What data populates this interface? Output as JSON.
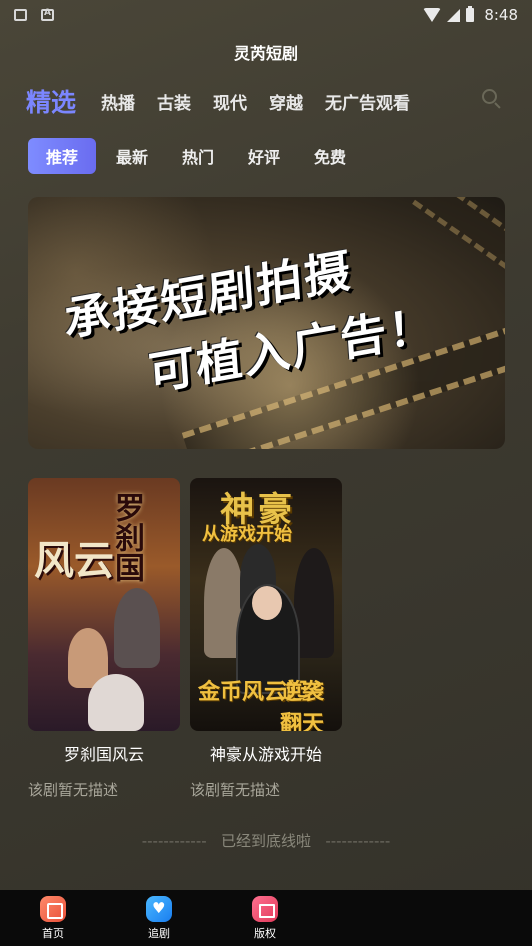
{
  "status_bar": {
    "time": "8:48",
    "left_icons": [
      "mail-icon",
      "a-app-icon"
    ],
    "right_icons": [
      "wifi-icon",
      "signal-icon",
      "battery-icon"
    ]
  },
  "app": {
    "title": "灵芮短剧"
  },
  "category_tabs": [
    {
      "label": "精选",
      "active": true
    },
    {
      "label": "热播",
      "active": false
    },
    {
      "label": "古装",
      "active": false
    },
    {
      "label": "现代",
      "active": false
    },
    {
      "label": "穿越",
      "active": false
    },
    {
      "label": "无广告观看",
      "active": false
    }
  ],
  "search": {
    "icon": "search-icon"
  },
  "sub_tabs": [
    {
      "label": "推荐",
      "active": true
    },
    {
      "label": "最新",
      "active": false
    },
    {
      "label": "热门",
      "active": false
    },
    {
      "label": "好评",
      "active": false
    },
    {
      "label": "免费",
      "active": false
    }
  ],
  "banner": {
    "line1": "承接短剧拍摄",
    "line2": "可植入广告！"
  },
  "dramas": [
    {
      "title": "罗刹国风云",
      "description": "该剧暂无描述",
      "poster_text_1": "风云",
      "poster_text_2": "罗刹国"
    },
    {
      "title": "神豪从游戏开始",
      "description": "该剧暂无描述",
      "poster_text_1": "神豪",
      "poster_text_2": "从游戏开始",
      "poster_text_3": "金币风云起",
      "poster_text_4": "逆袭翻天"
    }
  ],
  "end_message": "已经到底线啦",
  "bottom_nav": [
    {
      "label": "首页",
      "icon": "home-icon"
    },
    {
      "label": "追剧",
      "icon": "heart-icon"
    },
    {
      "label": "版权",
      "icon": "copyright-icon"
    }
  ],
  "colors": {
    "accent": "#7b86ff",
    "sub_tab_active": "#6e74f4",
    "background": "#3f3c32",
    "nav_background": "#0a0a0a"
  }
}
